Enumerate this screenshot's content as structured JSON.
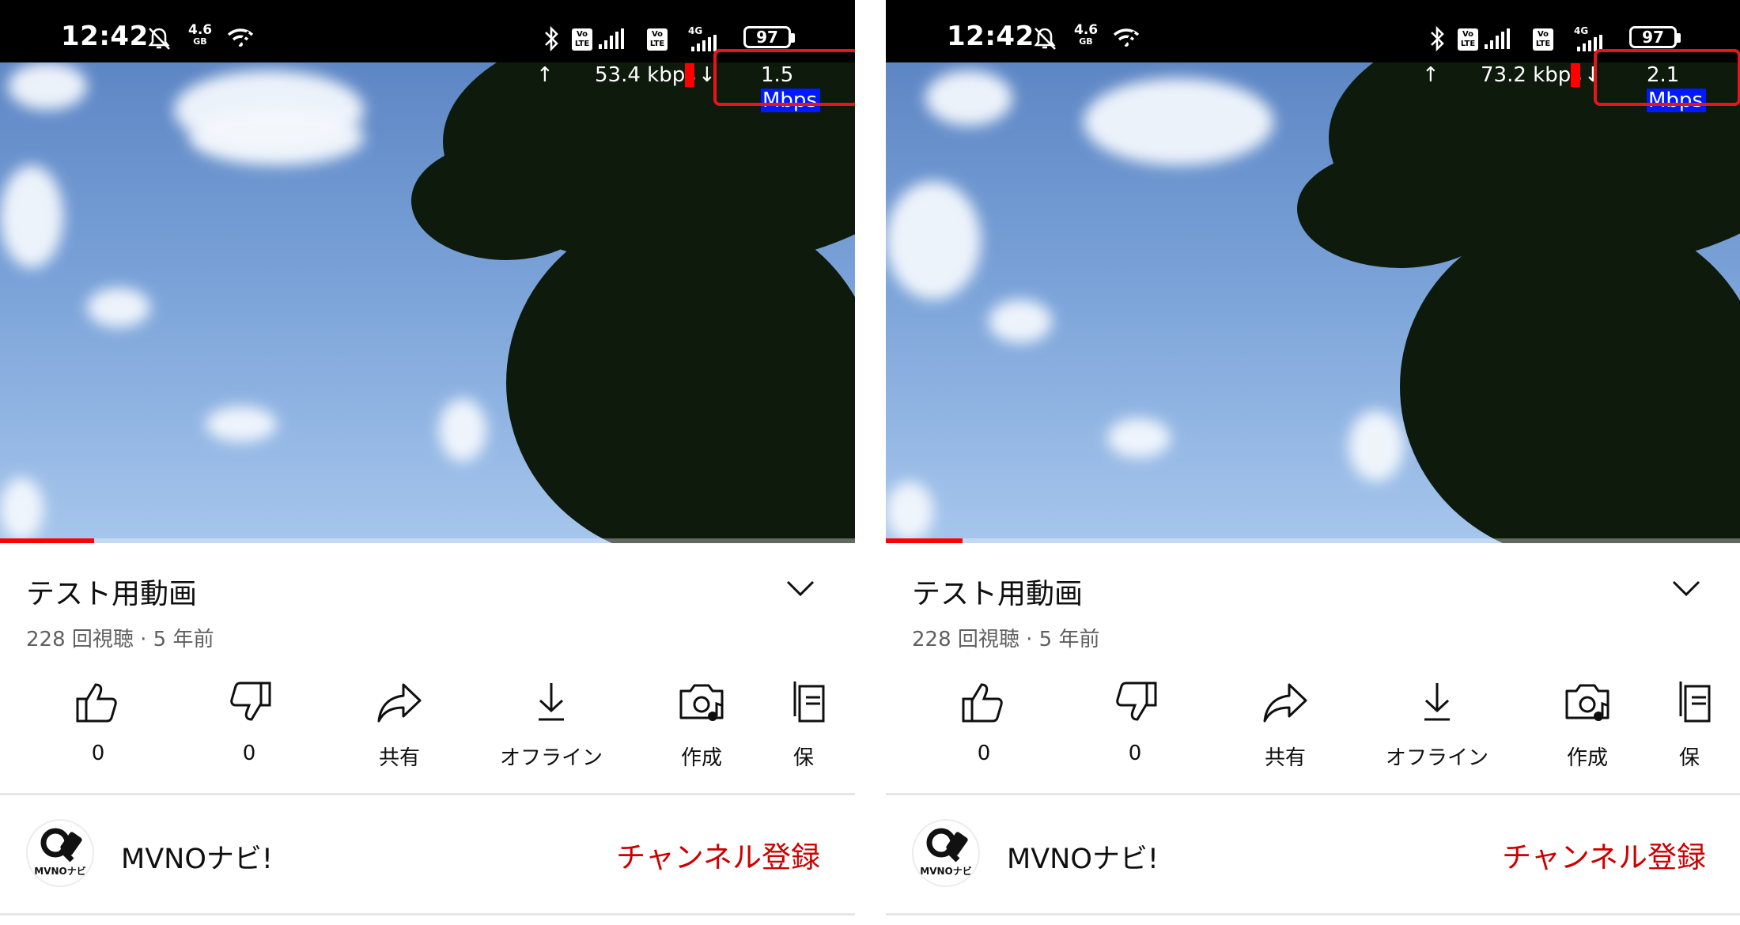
{
  "panels": [
    {
      "status_bar": {
        "time": "12:42",
        "network_speed": "4.6",
        "network_unit": "GB",
        "network_type": "4G",
        "battery": "97",
        "lte_badge": "Vo LTE"
      },
      "speed_overlay": {
        "upload": "53.4 kbps",
        "download_value": "1.5",
        "download_unit": "Mbps"
      },
      "video": {
        "progress": 0.11
      },
      "title": "テスト用動画",
      "meta": "228 回視聴 · 5 年前",
      "actions": {
        "like": "0",
        "dislike": "0",
        "share": "共有",
        "offline": "オフライン",
        "create": "作成",
        "save": "保"
      },
      "channel": {
        "name": "MVNOナビ!",
        "avatar_text": "MVNOナビ",
        "subscribe": "チャンネル登録"
      }
    },
    {
      "status_bar": {
        "time": "12:42",
        "network_speed": "4.6",
        "network_unit": "GB",
        "network_type": "4G",
        "battery": "97",
        "lte_badge": "Vo LTE"
      },
      "speed_overlay": {
        "upload": "73.2 kbps",
        "download_value": "2.1",
        "download_unit": "Mbps"
      },
      "video": {
        "progress": 0.09
      },
      "title": "テスト用動画",
      "meta": "228 回視聴 · 5 年前",
      "actions": {
        "like": "0",
        "dislike": "0",
        "share": "共有",
        "offline": "オフライン",
        "create": "作成",
        "save": "保"
      },
      "channel": {
        "name": "MVNOナビ!",
        "avatar_text": "MVNOナビ",
        "subscribe": "チャンネル登録"
      }
    }
  ],
  "colors": {
    "accent_red": "#ff0000",
    "highlight_box": "#e8141c",
    "unit_highlight": "#0019ff",
    "subscribe_text": "#cc0000"
  }
}
